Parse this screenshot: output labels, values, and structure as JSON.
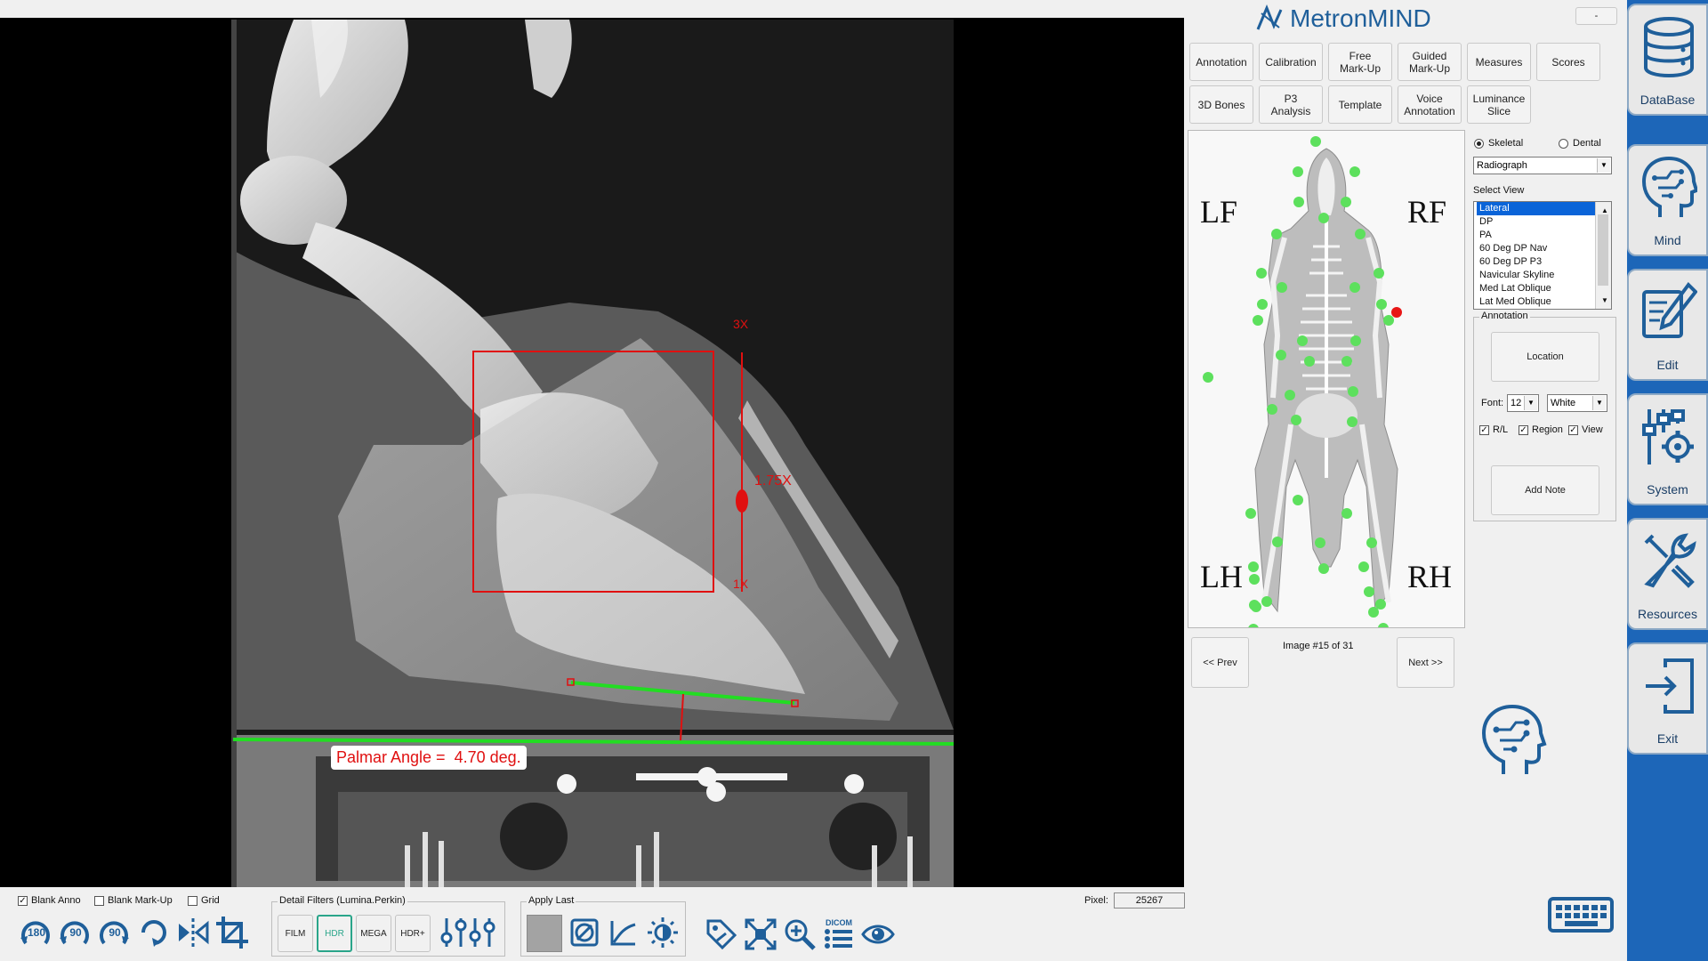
{
  "brand": {
    "name": "MetronMIND",
    "minimize_label": "-"
  },
  "annotation_overlay": {
    "palmar_angle": "Palmar Angle =  4.70 deg.",
    "scale_top": "3X",
    "scale_mid": "1.75X",
    "scale_bottom": "1X"
  },
  "toolbar_rows": [
    [
      "Annotation",
      "Calibration",
      "Free\nMark-Up",
      "Guided\nMark-Up",
      "Measures",
      "Scores"
    ],
    [
      "3D Bones",
      "P3\nAnalysis",
      "Template",
      "Voice\nAnnotation",
      "Luminance\nSlice"
    ]
  ],
  "skeleton": {
    "labels": {
      "lf": "LF",
      "rf": "RF",
      "lh": "LH",
      "rh": "RH"
    }
  },
  "mode": {
    "skeletal": "Skeletal",
    "dental": "Dental",
    "selected": "Skeletal"
  },
  "modality": {
    "value": "Radiograph"
  },
  "select_view": {
    "label": "Select View",
    "options": [
      "Lateral",
      "DP",
      "PA",
      "60 Deg DP Nav",
      "60 Deg DP P3",
      "Navicular Skyline",
      "Med Lat Oblique",
      "Lat Med Oblique"
    ],
    "selected": "Lateral"
  },
  "annotation_panel": {
    "title": "Annotation",
    "location": "Location",
    "font_label": "Font:",
    "font_size": "12",
    "font_color": "White",
    "rl": "R/L",
    "region": "Region",
    "view": "View",
    "add_note": "Add Note"
  },
  "navigation": {
    "prev": "<< Prev",
    "next": "Next >>",
    "image_counter": "Image #15 of 31"
  },
  "sidebar": [
    "DataBase",
    "Mind",
    "Edit",
    "System",
    "Resources",
    "Exit"
  ],
  "bottom": {
    "blank_anno": "Blank Anno",
    "blank_markup": "Blank Mark-Up",
    "grid": "Grid",
    "detail_filters": "Detail Filters  (Lumina.Perkin)",
    "filters": [
      "FILM",
      "HDR",
      "MEGA",
      "HDR+"
    ],
    "active_filter": "HDR",
    "apply_last": "Apply Last",
    "pixel_label": "Pixel:",
    "pixel_value": "25267",
    "rotate_labels": [
      "180",
      "90",
      "90"
    ],
    "dicom_label": "DICOM"
  },
  "colors": {
    "accent": "#1f5f9a",
    "sidebar": "#1d66b8",
    "dot_green": "#5de05d",
    "dot_red": "#e81616",
    "overlay_red": "#e01010",
    "line_green": "#22dd22"
  }
}
